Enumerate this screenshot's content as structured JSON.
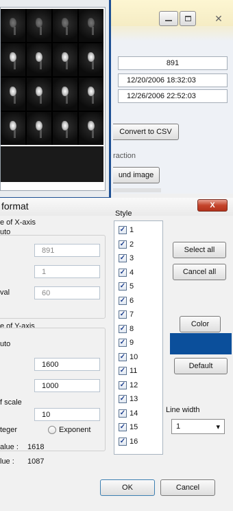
{
  "top_window": {
    "count_value": "891",
    "start_time_value": "12/20/2006 18:32:03",
    "end_time_value": "12/26/2006 22:52:03",
    "convert_button_label": "Convert to CSV",
    "extraction_label": "raction",
    "background_button_label": "und image",
    "preview_cells": 16
  },
  "format_dialog": {
    "title": "format",
    "close_label": "X",
    "x_axis": {
      "group_label": "e of X-axis",
      "auto_label": "uto",
      "max_value": "891",
      "min_value": "1",
      "interval_label": "val",
      "interval_value": "60"
    },
    "y_axis": {
      "group_label": "e of Y-axis",
      "auto_label": "uto",
      "max_value": "1600",
      "min_value": "1000",
      "scale_label": "f scale",
      "scale_value": "10",
      "integer_label": "teger",
      "exponent_label": "Exponent",
      "max_value_label": "alue :",
      "max_value_reading": "1618",
      "min_value_label": "lue :",
      "min_value_reading": "1087"
    },
    "style": {
      "label": "Style",
      "items": [
        "1",
        "2",
        "3",
        "4",
        "5",
        "6",
        "7",
        "8",
        "9",
        "10",
        "11",
        "12",
        "13",
        "14",
        "15",
        "16"
      ],
      "select_all_label": "Select all",
      "cancel_all_label": "Cancel all",
      "color_label": "Color",
      "color_value": "#0b4f9b",
      "default_label": "Default",
      "line_width_label": "Line width",
      "line_width_value": "1"
    },
    "ok_label": "OK",
    "cancel_label": "Cancel"
  }
}
